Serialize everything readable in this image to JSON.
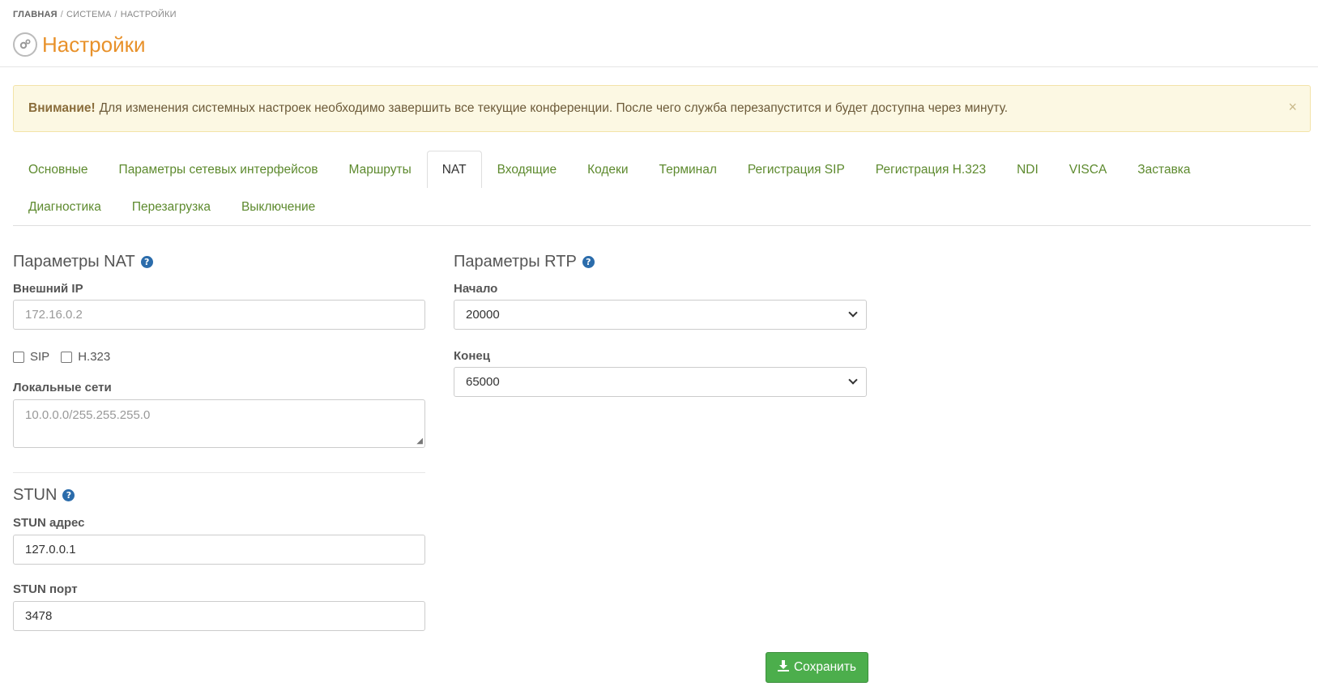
{
  "breadcrumb": [
    "ГЛАВНАЯ",
    "СИСТЕМА",
    "НАСТРОЙКИ"
  ],
  "page_title": "Настройки",
  "alert": {
    "strong": "Внимание!",
    "text": "Для изменения системных настроек необходимо завершить все текущие конференции. После чего служба перезапустится и будет доступна через минуту.",
    "close": "×"
  },
  "tabs": {
    "row1": [
      "Основные",
      "Параметры сетевых интерфейсов",
      "Маршруты",
      "NAT",
      "Входящие",
      "Кодеки",
      "Терминал",
      "Регистрация SIP",
      "Регистрация H.323",
      "NDI",
      "VISCA",
      "Заставка"
    ],
    "row2": [
      "Диагностика",
      "Перезагрузка",
      "Выключение"
    ],
    "active": "NAT"
  },
  "nat": {
    "title": "Параметры NAT",
    "external_ip_label": "Внешний IP",
    "external_ip_placeholder": "172.16.0.2",
    "sip_label": "SIP",
    "h323_label": "H.323",
    "local_networks_label": "Локальные сети",
    "local_networks_placeholder": "10.0.0.0/255.255.255.0"
  },
  "stun": {
    "title": "STUN",
    "address_label": "STUN адрес",
    "address_value": "127.0.0.1",
    "port_label": "STUN порт",
    "port_value": "3478"
  },
  "rtp": {
    "title": "Параметры RTP",
    "start_label": "Начало",
    "start_value": "20000",
    "end_label": "Конец",
    "end_value": "65000"
  },
  "save_label": "Сохранить",
  "colors": {
    "accent_title": "#e8912a",
    "tab_link": "#5d8a2e",
    "save_button": "#4cae4c",
    "help_icon": "#2b6cab",
    "alert_bg": "#fcf8e3"
  }
}
